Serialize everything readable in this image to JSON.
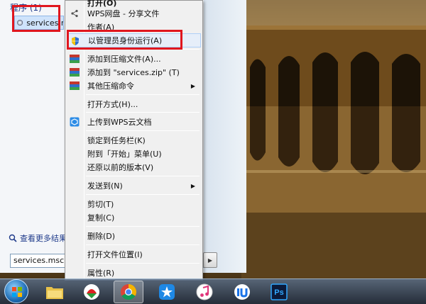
{
  "start_menu": {
    "section_title": "程序 (1)",
    "program_item": "services.msc",
    "see_more": "查看更多结果",
    "search_value": "services.msc",
    "shutdown_arrow": "▶"
  },
  "context_menu": {
    "items": [
      {
        "label": "打开(O)"
      },
      {
        "label": "WPS网盘 - 分享文件"
      },
      {
        "label": "作者(A)"
      },
      {
        "label": "以管理员身份运行(A)"
      },
      {
        "label": "添加到压缩文件(A)..."
      },
      {
        "label": "添加到 \"services.zip\" (T)"
      },
      {
        "label": "其他压缩命令"
      },
      {
        "label": "打开方式(H)..."
      },
      {
        "label": "上传到WPS云文档"
      },
      {
        "label": "锁定到任务栏(K)"
      },
      {
        "label": "附到「开始」菜单(U)"
      },
      {
        "label": "还原以前的版本(V)"
      },
      {
        "label": "发送到(N)"
      },
      {
        "label": "剪切(T)"
      },
      {
        "label": "复制(C)"
      },
      {
        "label": "删除(D)"
      },
      {
        "label": "打开文件位置(I)"
      },
      {
        "label": "属性(R)"
      }
    ],
    "submenu_arrow": "▶"
  },
  "taskbar": {
    "apps": [
      {
        "name": "explorer"
      },
      {
        "name": "wps"
      },
      {
        "name": "chrome"
      },
      {
        "name": "star-app"
      },
      {
        "name": "itunes"
      },
      {
        "name": "iu-app"
      },
      {
        "name": "photoshop",
        "text": "Ps"
      }
    ]
  },
  "colors": {
    "highlight_border": "#e0161e",
    "accent": "#1e3a8a"
  }
}
